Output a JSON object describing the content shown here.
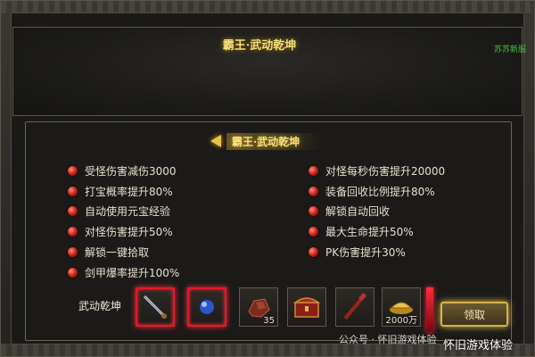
{
  "header": {
    "title": "霸王·武动乾坤",
    "top_right_tag": "苏苏新服"
  },
  "panel": {
    "subtitle": "霸王·武动乾坤",
    "left_bullets": [
      "受怪伤害减伤3000",
      "打宝概率提升80%",
      "自动使用元宝经验",
      "对怪伤害提升50%",
      "解锁一键拾取",
      "剑甲爆率提升100%"
    ],
    "right_bullets": [
      "对怪每秒伤害提升20000",
      "装备回收比例提升80%",
      "解锁自动回收",
      "最大生命提升50%",
      "PK伤害提升30%"
    ],
    "reward_label": "武动乾坤",
    "reward_items": [
      {
        "icon": "sword-icon",
        "count": "",
        "highlight": true
      },
      {
        "icon": "blue-orb-icon",
        "count": "",
        "highlight": true
      },
      {
        "icon": "ore-icon",
        "count": "35",
        "highlight": false
      },
      {
        "icon": "treasure-chest-icon",
        "count": "",
        "highlight": false
      },
      {
        "icon": "red-staff-icon",
        "count": "",
        "highlight": false
      },
      {
        "icon": "gold-ingot-icon",
        "count": "2000万",
        "highlight": false
      }
    ],
    "claim_button": "领取"
  },
  "watermark": {
    "source": "公众号 · 怀旧游戏体验",
    "brand": "怀旧游戏体验"
  },
  "colors": {
    "gold_text": "#f4de7a",
    "highlight_red": "#e2182a",
    "bullet_red": "#c21b13",
    "tag_green": "#3ec43a"
  }
}
